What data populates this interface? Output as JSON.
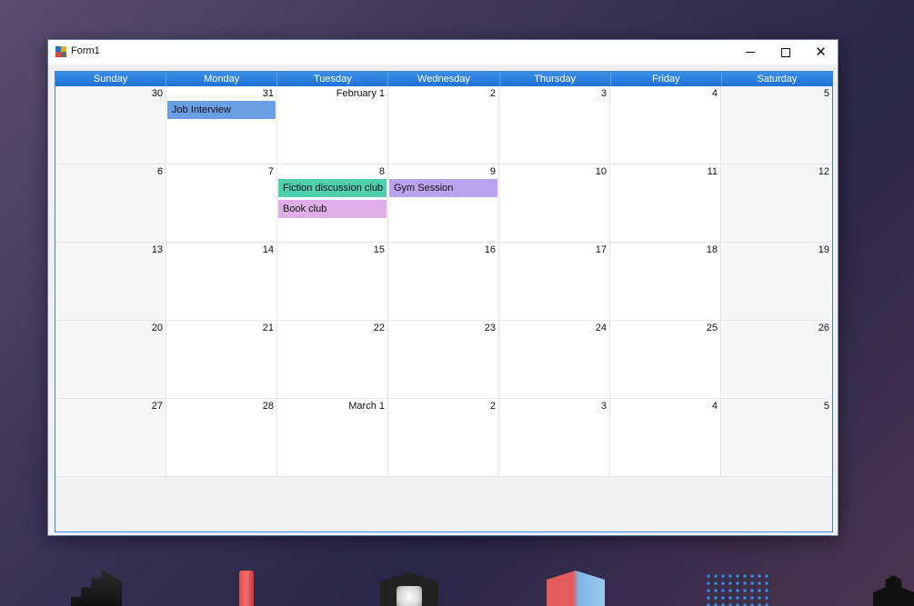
{
  "window": {
    "title": "Form1"
  },
  "window_controls": {
    "minimize": "minimize",
    "maximize": "maximize",
    "close": "close"
  },
  "calendar": {
    "weekdays": [
      "Sunday",
      "Monday",
      "Tuesday",
      "Wednesday",
      "Thursday",
      "Friday",
      "Saturday"
    ],
    "weeks": [
      [
        "30",
        "31",
        "February 1",
        "2",
        "3",
        "4",
        "5"
      ],
      [
        "6",
        "7",
        "8",
        "9",
        "10",
        "11",
        "12"
      ],
      [
        "13",
        "14",
        "15",
        "16",
        "17",
        "18",
        "19"
      ],
      [
        "20",
        "21",
        "22",
        "23",
        "24",
        "25",
        "26"
      ],
      [
        "27",
        "28",
        "March 1",
        "2",
        "3",
        "4",
        "5"
      ]
    ],
    "events": [
      {
        "title": "Job Interview",
        "week": 0,
        "day": 1,
        "slot": 0,
        "color": "#6a9fe3"
      },
      {
        "title": "Fiction discussion club",
        "week": 1,
        "day": 2,
        "slot": 0,
        "color": "#4ecfb0"
      },
      {
        "title": "Gym Session",
        "week": 1,
        "day": 3,
        "slot": 0,
        "color": "#b9a3ec"
      },
      {
        "title": "Book club",
        "week": 1,
        "day": 2,
        "slot": 1,
        "color": "#dfaee6"
      }
    ],
    "colors": {
      "header": "#1f72d6",
      "border": "#3c86d8"
    }
  }
}
